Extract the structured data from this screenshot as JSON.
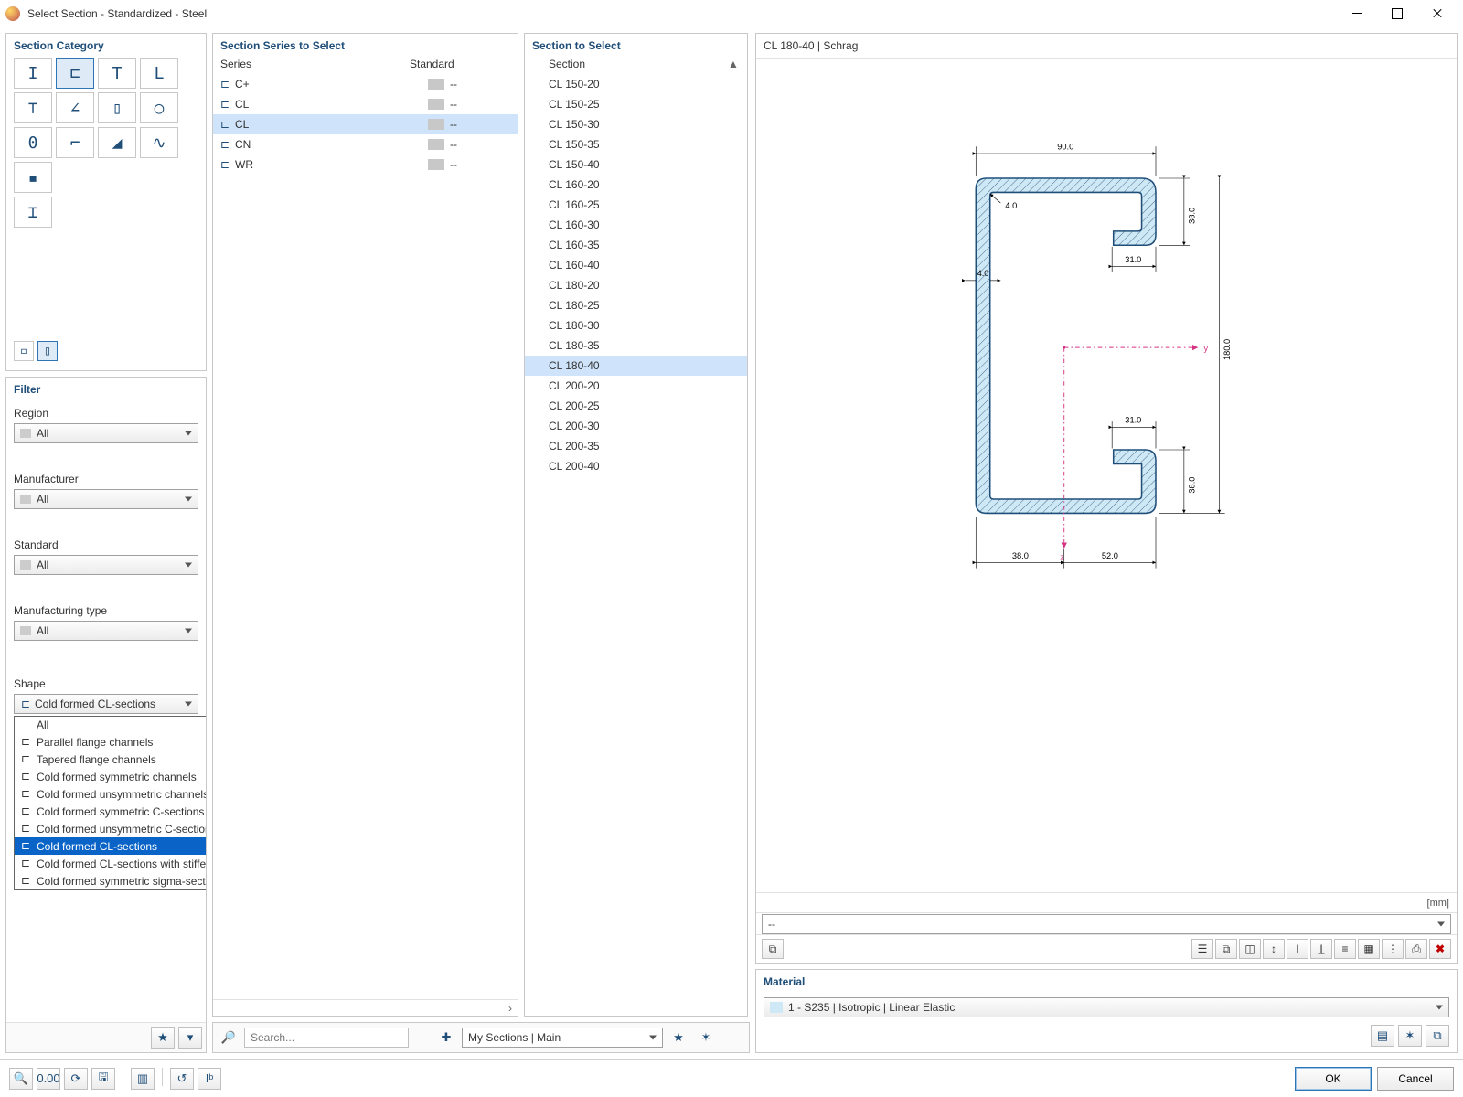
{
  "window": {
    "title": "Select Section - Standardized - Steel"
  },
  "left": {
    "category_title": "Section Category",
    "categories": [
      {
        "glyph": "I",
        "name": "i-section"
      },
      {
        "glyph": "⊏",
        "name": "channel-section",
        "selected": true
      },
      {
        "glyph": "T",
        "name": "t-section"
      },
      {
        "glyph": "L",
        "name": "angle-section"
      },
      {
        "glyph": "⊤",
        "name": "double-t-section"
      },
      {
        "glyph": "∠",
        "name": "z-section"
      },
      {
        "glyph": "▯",
        "name": "hollow-rect"
      },
      {
        "glyph": "○",
        "name": "hollow-round"
      },
      {
        "glyph": "0",
        "name": "solid-oval"
      },
      {
        "glyph": "⌐",
        "name": "l-bent"
      },
      {
        "glyph": "◢",
        "name": "rail"
      },
      {
        "glyph": "∿",
        "name": "corrugated"
      },
      {
        "glyph": "▪",
        "name": "solid-bar"
      },
      {
        "glyph": "⌶",
        "name": "built-up"
      }
    ],
    "subcat": [
      {
        "glyph": "▫",
        "name": "thin-walled-off"
      },
      {
        "glyph": "▯",
        "name": "thin-walled-on",
        "selected": true
      }
    ],
    "filter_title": "Filter",
    "filters": {
      "region": {
        "label": "Region",
        "value": "All"
      },
      "manufacturer": {
        "label": "Manufacturer",
        "value": "All"
      },
      "standard": {
        "label": "Standard",
        "value": "All"
      },
      "manuf_type": {
        "label": "Manufacturing type",
        "value": "All"
      },
      "shape": {
        "label": "Shape",
        "value": "Cold formed CL-sections"
      }
    },
    "shape_options": [
      {
        "label": "All"
      },
      {
        "label": "Parallel flange channels"
      },
      {
        "label": "Tapered flange channels"
      },
      {
        "label": "Cold formed symmetric channels"
      },
      {
        "label": "Cold formed unsymmetric channels"
      },
      {
        "label": "Cold formed symmetric C-sections"
      },
      {
        "label": "Cold formed unsymmetric C-sections"
      },
      {
        "label": "Cold formed CL-sections",
        "selected": true
      },
      {
        "label": "Cold formed CL-sections with stiffened web"
      },
      {
        "label": "Cold formed symmetric sigma-sections"
      }
    ],
    "filter_icons": [
      {
        "glyph": "★",
        "name": "favorite-filter-icon"
      },
      {
        "glyph": "▾",
        "name": "filter-funnel-icon"
      }
    ]
  },
  "series": {
    "title": "Section Series to Select",
    "head_series": "Series",
    "head_standard": "Standard",
    "rows": [
      {
        "name": "C+",
        "standard": "--"
      },
      {
        "name": "CL",
        "standard": "--"
      },
      {
        "name": "CL",
        "standard": "--",
        "selected": true
      },
      {
        "name": "CN",
        "standard": "--"
      },
      {
        "name": "WR",
        "standard": "--"
      }
    ]
  },
  "sections": {
    "title": "Section to Select",
    "head": "Section",
    "rows": [
      {
        "name": "CL 150-20"
      },
      {
        "name": "CL 150-25"
      },
      {
        "name": "CL 150-30"
      },
      {
        "name": "CL 150-35"
      },
      {
        "name": "CL 150-40"
      },
      {
        "name": "CL 160-20"
      },
      {
        "name": "CL 160-25"
      },
      {
        "name": "CL 160-30"
      },
      {
        "name": "CL 160-35"
      },
      {
        "name": "CL 160-40"
      },
      {
        "name": "CL 180-20"
      },
      {
        "name": "CL 180-25"
      },
      {
        "name": "CL 180-30"
      },
      {
        "name": "CL 180-35"
      },
      {
        "name": "CL 180-40",
        "selected": true
      },
      {
        "name": "CL 200-20"
      },
      {
        "name": "CL 200-25"
      },
      {
        "name": "CL 200-30"
      },
      {
        "name": "CL 200-35"
      },
      {
        "name": "CL 200-40"
      }
    ]
  },
  "mid_bottom": {
    "search_placeholder": "Search...",
    "mysections_label": "My Sections | Main"
  },
  "preview": {
    "title": "CL 180-40 | Schrag",
    "unit": "[mm]",
    "info_value": "--",
    "dims": {
      "h": "180.0",
      "b": "90.0",
      "c_top": "38.0",
      "c_bot": "38.0",
      "t": "4.0",
      "r": "4.0",
      "lip": "31.0",
      "ez_left": "38.0",
      "ez_right": "52.0",
      "axis_y": "y",
      "axis_z": "z"
    },
    "toolbar": [
      {
        "glyph": "☰",
        "name": "values-icon"
      },
      {
        "glyph": "⧉",
        "name": "stresses-icon"
      },
      {
        "glyph": "◫",
        "name": "thinwalled-icon"
      },
      {
        "glyph": "↕",
        "name": "axes-icon"
      },
      {
        "glyph": "I",
        "name": "principal-icon"
      },
      {
        "glyph": "I̲",
        "name": "dim-icon"
      },
      {
        "glyph": "≡",
        "name": "dim-lines-icon"
      },
      {
        "glyph": "▦",
        "name": "grid-icon"
      },
      {
        "glyph": "⋮",
        "name": "legend-icon"
      },
      {
        "glyph": "⎙",
        "name": "print-icon"
      },
      {
        "glyph": "✖",
        "name": "clear-icon",
        "red": true
      }
    ]
  },
  "material": {
    "title": "Material",
    "value": "1 - S235 | Isotropic | Linear Elastic",
    "icons": [
      {
        "glyph": "▤",
        "name": "library-icon"
      },
      {
        "glyph": "✶",
        "name": "new-material-icon"
      },
      {
        "glyph": "⧉",
        "name": "edit-material-icon"
      }
    ]
  },
  "bottom_toolbar": [
    {
      "glyph": "🔍",
      "name": "search-tool-icon"
    },
    {
      "glyph": "0.00",
      "name": "units-tool-icon"
    },
    {
      "glyph": "⟳",
      "name": "refresh-tool-icon"
    },
    {
      "glyph": "🖫",
      "name": "save-tool-icon"
    },
    {
      "glyph": "▥",
      "name": "copy-tool-icon"
    },
    {
      "glyph": "↺",
      "name": "reset-tool-icon"
    },
    {
      "glyph": "Iᵇ",
      "name": "section-props-icon"
    }
  ],
  "buttons": {
    "ok": "OK",
    "cancel": "Cancel"
  }
}
